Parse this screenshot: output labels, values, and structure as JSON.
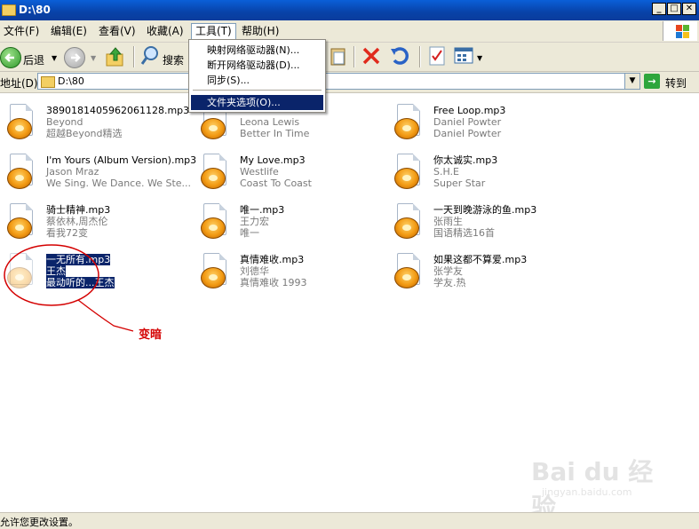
{
  "window": {
    "title": "D:\\80"
  },
  "menubar": {
    "items": [
      "文件(F)",
      "编辑(E)",
      "查看(V)",
      "收藏(A)",
      "工具(T)",
      "帮助(H)"
    ]
  },
  "toolbar": {
    "back_label": "后退",
    "search_label": "搜索"
  },
  "tools_menu": {
    "items": [
      "映射网络驱动器(N)...",
      "断开网络驱动器(D)...",
      "同步(S)...",
      "文件夹选项(O)..."
    ]
  },
  "address": {
    "label": "地址(D)",
    "value": "D:\\80",
    "go_label": "转到"
  },
  "files": [
    {
      "name": "3890181405962061128.mp3",
      "artist": "Beyond",
      "album": "超越Beyond精选"
    },
    {
      "name": "",
      "artist": "Leona Lewis",
      "album": "Better In Time"
    },
    {
      "name": "Free Loop.mp3",
      "artist": "Daniel Powter",
      "album": "Daniel Powter"
    },
    {
      "name": "I'm Yours (Album Version).mp3",
      "artist": "Jason Mraz",
      "album": "We Sing. We Dance. We Ste..."
    },
    {
      "name": "My Love.mp3",
      "artist": "Westlife",
      "album": "Coast To Coast"
    },
    {
      "name": "你太诚实.mp3",
      "artist": "S.H.E",
      "album": "Super Star"
    },
    {
      "name": "骑士精神.mp3",
      "artist": "蔡依林,周杰伦",
      "album": "看我72变"
    },
    {
      "name": "唯一.mp3",
      "artist": "王力宏",
      "album": "唯一"
    },
    {
      "name": "一天到晚游泳的鱼.mp3",
      "artist": "张雨生",
      "album": "国语精选16首"
    },
    {
      "name": "一无所有.mp3",
      "artist": "王杰",
      "album": "最动听的...王杰"
    },
    {
      "name": "真情难收.mp3",
      "artist": "刘德华",
      "album": "真情难收 1993"
    },
    {
      "name": "如果这都不算爱.mp3",
      "artist": "张学友",
      "album": "学友.热"
    }
  ],
  "annotation": {
    "text": "变暗"
  },
  "status": {
    "text": "允许您更改设置。"
  },
  "watermark": {
    "brand": "Bai du 经验",
    "url": "jingyan.baidu.com"
  }
}
